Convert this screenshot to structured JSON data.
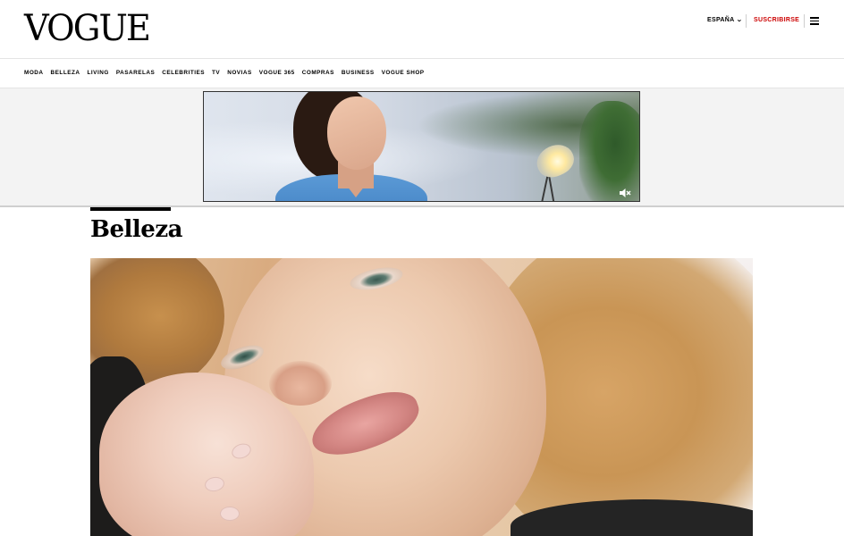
{
  "header": {
    "logo": "VOGUE",
    "edition": "ESPAÑA",
    "subscribe": "SUSCRIBIRSE"
  },
  "nav": {
    "items": [
      "MODA",
      "BELLEZA",
      "LIVING",
      "PASARELAS",
      "CELEBRITIES",
      "TV",
      "NOVIAS",
      "VOGUE 365",
      "COMPRAS",
      "BUSINESS",
      "VOGUE SHOP"
    ]
  },
  "section": {
    "title": "Belleza"
  },
  "icons": {
    "edition_chevron": "chevron-down-icon",
    "menu": "hamburger-menu-icon",
    "ad_mute": "speaker-muted-icon"
  },
  "colors": {
    "accent_red": "#cc0000",
    "text": "#000000",
    "ad_background": "#f3f3f3"
  }
}
